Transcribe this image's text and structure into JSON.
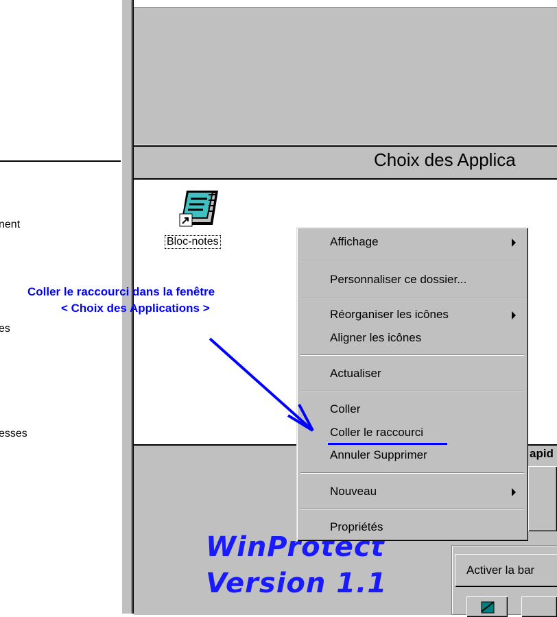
{
  "left_pane": {
    "items": [
      "nent",
      "es",
      "esses"
    ]
  },
  "header": {
    "title": "Choix des Applica"
  },
  "desktop_icon": {
    "label": "Bloc-notes",
    "icon": "notepad-shortcut-icon"
  },
  "annotation": {
    "line1": "Coller le raccourci dans la fenêtre",
    "line2": "< Choix des Applications >",
    "color": "#0000ff"
  },
  "context_menu": {
    "items": [
      {
        "label": "Affichage",
        "has_submenu": true
      },
      {
        "label": "Personnaliser ce dossier..."
      },
      {
        "label": "Réorganiser les icônes",
        "has_submenu": true
      },
      {
        "label": "Aligner les icônes"
      },
      {
        "label": "Actualiser"
      },
      {
        "label": "Coller"
      },
      {
        "label": "Coller le raccourci",
        "highlighted_by_annotation": true
      },
      {
        "label": "Annuler Supprimer"
      },
      {
        "label": "Nouveau",
        "has_submenu": true
      },
      {
        "label": "Propriétés"
      }
    ]
  },
  "bottom_panel": {
    "logo_line1": "WinProtect",
    "logo_line2": "Version 1.1",
    "rapid_label": "apid",
    "activate_button": "Activer la bar"
  },
  "colors": {
    "window_gray": "#c0c0c0",
    "accent_blue": "#0000ff",
    "logo_blue": "#1a1aff"
  }
}
